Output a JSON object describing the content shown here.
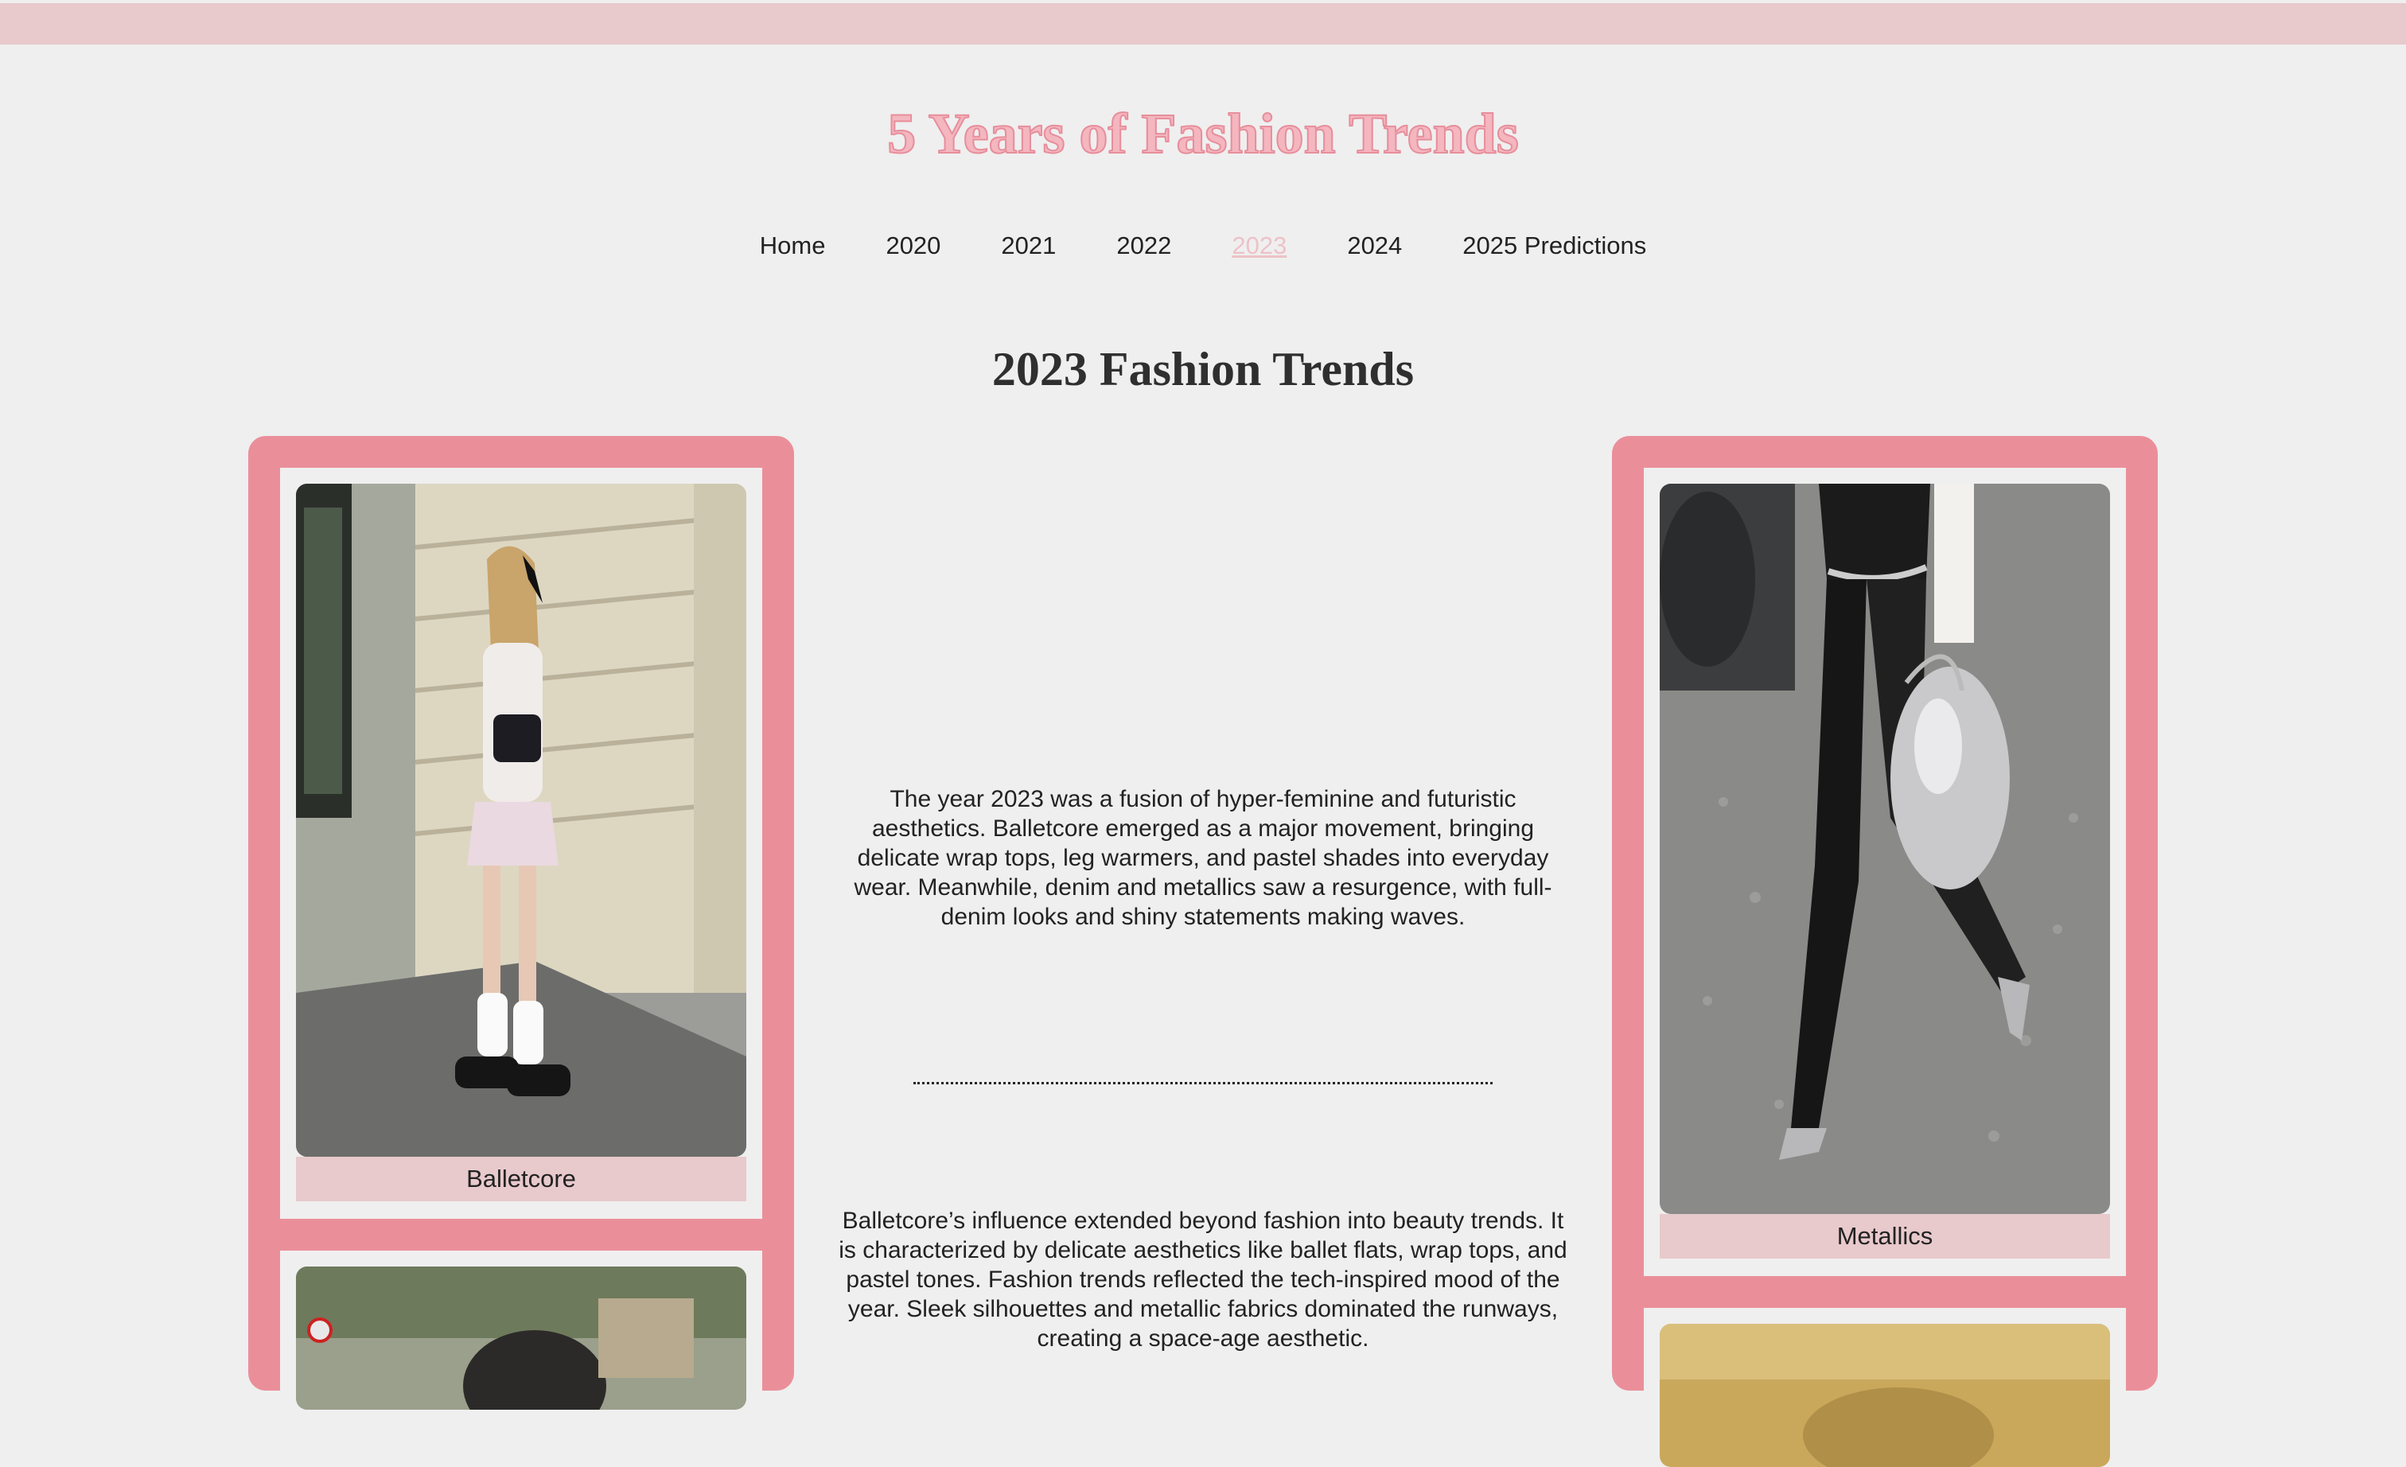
{
  "site": {
    "title": "5 Years of Fashion Trends"
  },
  "nav": {
    "items": [
      {
        "label": "Home"
      },
      {
        "label": "2020"
      },
      {
        "label": "2021"
      },
      {
        "label": "2022"
      },
      {
        "label": "2023",
        "active": true
      },
      {
        "label": "2024"
      },
      {
        "label": "2025 Predictions"
      }
    ]
  },
  "page": {
    "heading": "2023 Fashion Trends"
  },
  "left_panel": {
    "cards": [
      {
        "caption": "Balletcore",
        "image": "balletcore-photo"
      },
      {
        "caption": "",
        "image": "second-trend-photo"
      }
    ]
  },
  "right_panel": {
    "cards": [
      {
        "caption": "Metallics",
        "image": "metallics-photo"
      },
      {
        "caption": "",
        "image": "third-trend-photo"
      }
    ]
  },
  "content": {
    "paragraph_1": "The year 2023 was a fusion of hyper-feminine and futuristic aesthetics. Balletcore emerged as a major movement, bringing delicate wrap tops, leg warmers, and pastel shades into everyday wear. Meanwhile, denim and metallics saw a resurgence, with full-denim looks and shiny statements making waves.",
    "paragraph_2": "Balletcore’s influence extended beyond fashion into beauty trends. It is characterized by delicate aesthetics like ballet flats, wrap tops, and pastel tones. Fashion trends reflected the tech-inspired mood of the year. Sleek silhouettes and metallic fabrics dominated the runways, creating a space-age aesthetic."
  },
  "colors": {
    "accent_pink": "#ea8f9a",
    "light_pink": "#e8c9cc",
    "background": "#efefef"
  }
}
